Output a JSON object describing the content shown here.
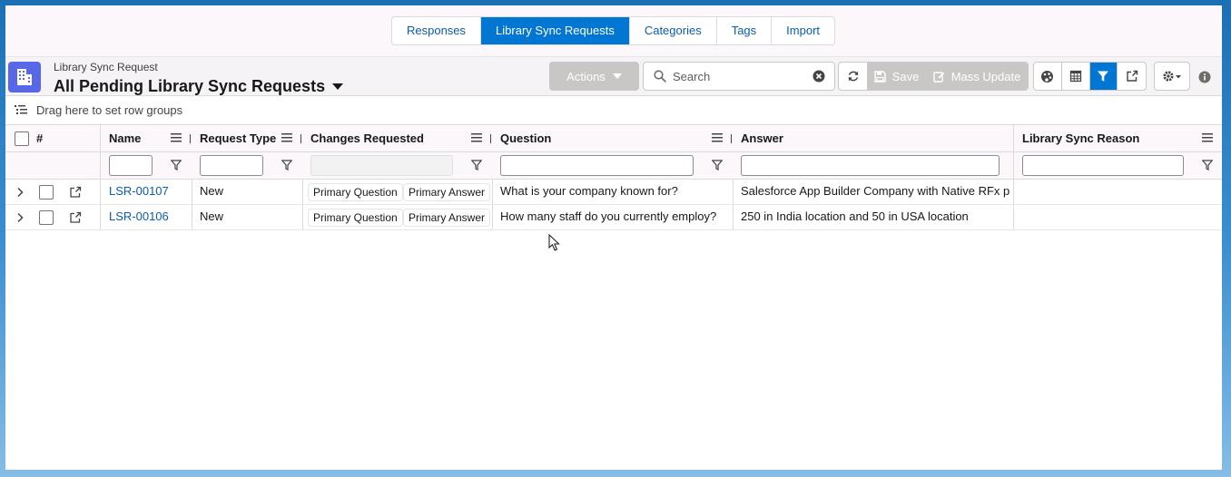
{
  "tabs": [
    {
      "label": "Responses",
      "active": false
    },
    {
      "label": "Library Sync Requests",
      "active": true
    },
    {
      "label": "Categories",
      "active": false
    },
    {
      "label": "Tags",
      "active": false
    },
    {
      "label": "Import",
      "active": false
    }
  ],
  "header": {
    "object_label": "Library Sync Request",
    "list_view_title": "All Pending Library Sync Requests",
    "actions_label": "Actions",
    "search_placeholder": "Search",
    "save_label": "Save",
    "mass_update_label": "Mass Update"
  },
  "groupbar": {
    "label": "Drag here to set row groups"
  },
  "grid": {
    "columns": {
      "index": "#",
      "name": "Name",
      "request_type": "Request Type",
      "changes_requested": "Changes Requested",
      "question": "Question",
      "answer": "Answer",
      "library_sync_reason": "Library Sync Reason"
    },
    "rows": [
      {
        "name": "LSR-00107",
        "request_type": "New",
        "changes": [
          "Primary Question",
          "Primary Answer"
        ],
        "question": "What is your company known for?",
        "answer": "Salesforce App Builder Company with Native RFx p",
        "reason": ""
      },
      {
        "name": "LSR-00106",
        "request_type": "New",
        "changes": [
          "Primary Question",
          "Primary Answer"
        ],
        "question": "How many staff do you currently employ?",
        "answer": "250 in India location and 50 in USA location",
        "reason": ""
      }
    ]
  },
  "colors": {
    "brand_blue": "#0176d3",
    "link_blue": "#0b5cab",
    "object_icon": "#5867e8",
    "disabled_button": "#c9c7c5"
  },
  "icons": {
    "object": "building-grid-icon",
    "search": "search-icon",
    "clear": "clear-icon",
    "refresh": "refresh-icon",
    "save": "save-icon",
    "mass_update": "edit-icon",
    "palette": "palette-icon",
    "table": "table-icon",
    "filter": "filter-icon",
    "popout": "popout-icon",
    "settings": "gear-icon",
    "info": "info-icon",
    "row_group": "row-group-icon",
    "expand": "chevron-right-icon",
    "column_menu": "menu-icon"
  }
}
